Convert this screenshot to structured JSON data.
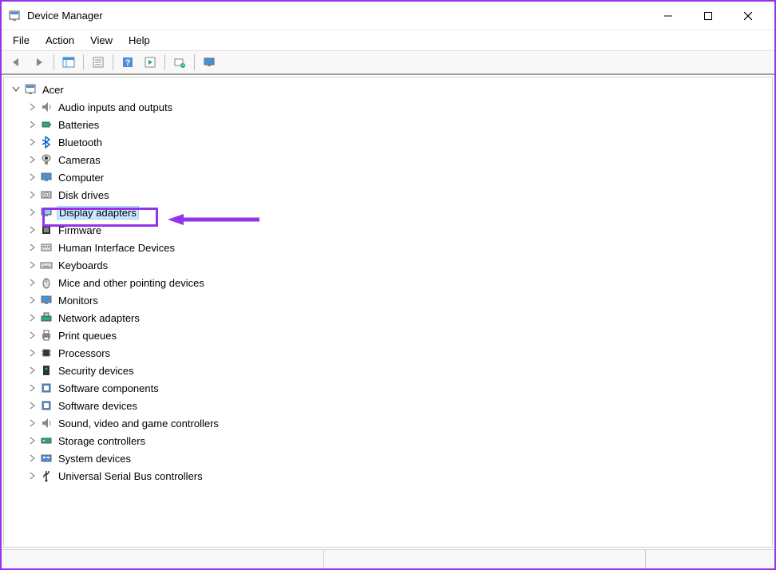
{
  "window": {
    "title": "Device Manager"
  },
  "menu": {
    "items": [
      "File",
      "Action",
      "View",
      "Help"
    ]
  },
  "tree": {
    "root": "Acer",
    "categories": [
      {
        "label": "Audio inputs and outputs",
        "icon": "audio"
      },
      {
        "label": "Batteries",
        "icon": "battery"
      },
      {
        "label": "Bluetooth",
        "icon": "bluetooth"
      },
      {
        "label": "Cameras",
        "icon": "camera"
      },
      {
        "label": "Computer",
        "icon": "computer"
      },
      {
        "label": "Disk drives",
        "icon": "disk"
      },
      {
        "label": "Display adapters",
        "icon": "display",
        "selected": true,
        "highlighted": true
      },
      {
        "label": "Firmware",
        "icon": "firmware"
      },
      {
        "label": "Human Interface Devices",
        "icon": "hid"
      },
      {
        "label": "Keyboards",
        "icon": "keyboard"
      },
      {
        "label": "Mice and other pointing devices",
        "icon": "mouse"
      },
      {
        "label": "Monitors",
        "icon": "monitor"
      },
      {
        "label": "Network adapters",
        "icon": "network"
      },
      {
        "label": "Print queues",
        "icon": "printer"
      },
      {
        "label": "Processors",
        "icon": "cpu"
      },
      {
        "label": "Security devices",
        "icon": "security"
      },
      {
        "label": "Software components",
        "icon": "software"
      },
      {
        "label": "Software devices",
        "icon": "software"
      },
      {
        "label": "Sound, video and game controllers",
        "icon": "sound"
      },
      {
        "label": "Storage controllers",
        "icon": "storage"
      },
      {
        "label": "System devices",
        "icon": "system"
      },
      {
        "label": "Universal Serial Bus controllers",
        "icon": "usb"
      }
    ]
  }
}
